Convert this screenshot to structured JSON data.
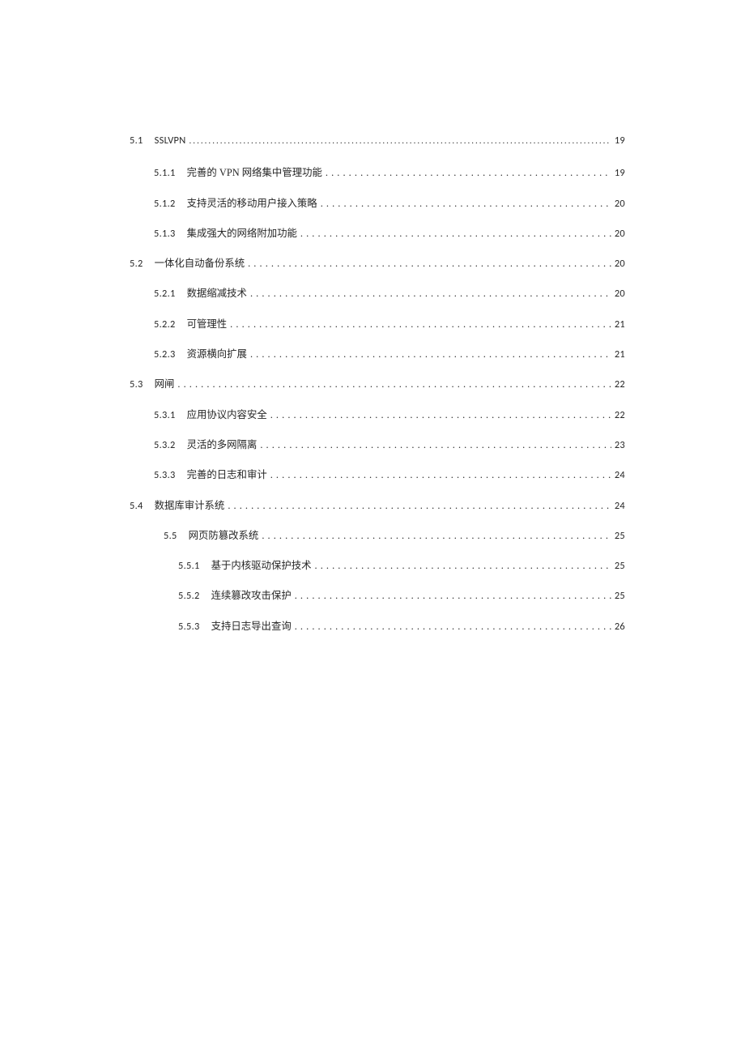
{
  "toc": {
    "e51": {
      "label": "5.1",
      "title": "SSLVPN",
      "page": "19"
    },
    "e511": {
      "label": "5.1.1",
      "title": "完善的 VPN 网络集中管理功能",
      "page": "19"
    },
    "e512": {
      "label": "5.1.2",
      "title": "支持灵活的移动用户接入策略",
      "page": "20"
    },
    "e513": {
      "label": "5.1.3",
      "title": "集成强大的网络附加功能",
      "page": "20"
    },
    "e52": {
      "label": "5.2",
      "title": "一体化自动备份系统",
      "page": "20"
    },
    "e521": {
      "label": "5.2.1",
      "title": "数据缩减技术",
      "page": "20"
    },
    "e522": {
      "label": "5.2.2",
      "title": "可管理性",
      "page": "21"
    },
    "e523": {
      "label": "5.2.3",
      "title": "资源横向扩展",
      "page": "21"
    },
    "e53": {
      "label": "5.3",
      "title": "网闸",
      "page": "22"
    },
    "e531": {
      "label": "5.3.1",
      "title": "应用协议内容安全",
      "page": "22"
    },
    "e532": {
      "label": "5.3.2",
      "title": "灵活的多网隔离",
      "page": "23"
    },
    "e533": {
      "label": "5.3.3",
      "title": "完善的日志和审计",
      "page": "24"
    },
    "e54": {
      "label": "5.4",
      "title": "数据库审计系统",
      "page": "24"
    },
    "e55": {
      "label": "5.5",
      "title": "网页防篡改系统",
      "page": "25"
    },
    "e551": {
      "label": "5.5.1",
      "title": "基于内核驱动保护技术",
      "page": "25"
    },
    "e552": {
      "label": "5.5.2",
      "title": "连续篡改攻击保护",
      "page": "25"
    },
    "e553": {
      "label": "5.5.3",
      "title": "支持日志导出查询",
      "page": "26"
    }
  },
  "leaders": {
    "thin": ".................................................................................................................................................................",
    "wide": ". . . . . . . . . . . . . . . . . . . . . . . . . . . . . . . . . . . . . . . . . . . . . . . . . . . . . . . . . . . . . . . . . . . . . . . . . . . . . . . . . . . . . . . . . . . . . . . . . . . . . . . . . . . . . . . . . ."
  }
}
